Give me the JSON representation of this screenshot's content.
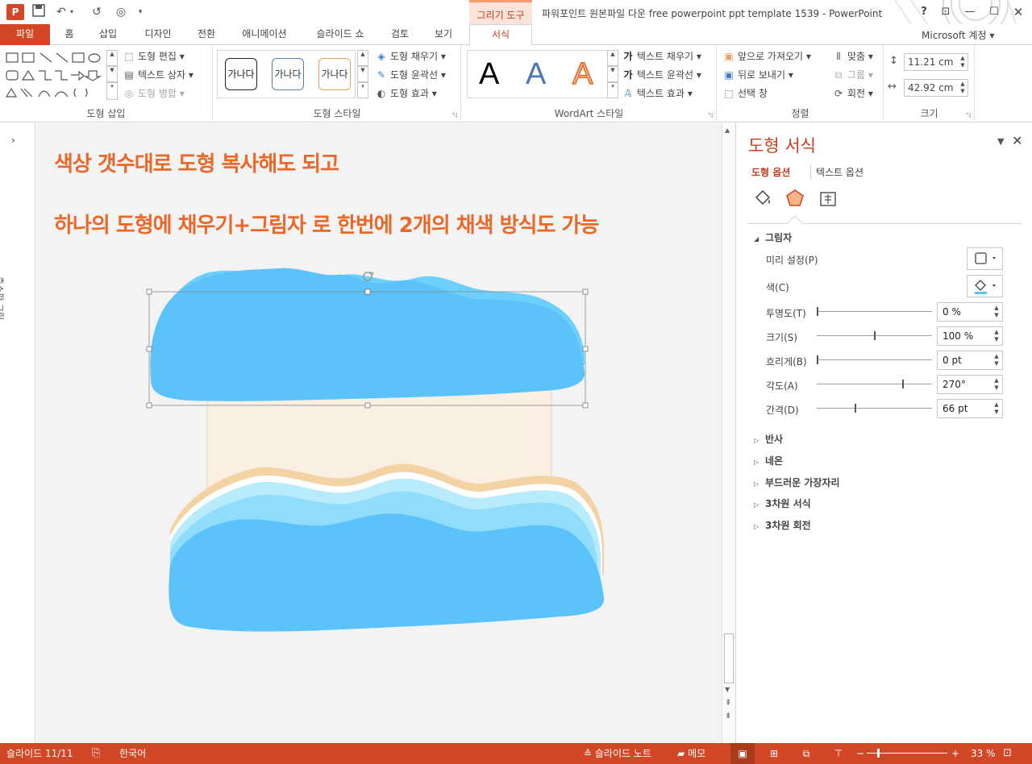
{
  "app": {
    "logo": "P",
    "window_title": "파워포인트 원본파일 다운 free powerpoint ppt template 1539 - PowerPoint",
    "context_label": "그리기 도구",
    "account": "Microsoft 계정"
  },
  "qat": {
    "save": "save-icon",
    "undo": "undo-icon",
    "redo": "redo-icon",
    "present": "present-icon",
    "customize": "customize-icon"
  },
  "window_buttons": {
    "help": "?",
    "ribbon_options": "ribbon-display-icon",
    "minimize": "minimize-icon",
    "restore": "restore-icon",
    "close": "close-icon"
  },
  "tabs": [
    {
      "id": "file",
      "label": "파일"
    },
    {
      "id": "home",
      "label": "홈"
    },
    {
      "id": "insert",
      "label": "삽입"
    },
    {
      "id": "design",
      "label": "디자인"
    },
    {
      "id": "transitions",
      "label": "전환"
    },
    {
      "id": "animations",
      "label": "애니메이션"
    },
    {
      "id": "slideshow",
      "label": "슬라이드 쇼"
    },
    {
      "id": "review",
      "label": "검토"
    },
    {
      "id": "view",
      "label": "보기"
    },
    {
      "id": "format",
      "label": "서식"
    }
  ],
  "ribbon": {
    "insert_shapes": {
      "label": "도형 삽입",
      "edit_shape": "도형 편집",
      "text_box": "텍스트 상자",
      "merge_shapes": "도형 병합"
    },
    "shape_styles": {
      "label": "도형 스타일",
      "sample_text": "가나다",
      "fill": "도형 채우기",
      "outline": "도형 윤곽선",
      "effects": "도형 효과",
      "style_colors": [
        "#222222",
        "#5b7fa6",
        "#e8a15a"
      ]
    },
    "wordart_styles": {
      "label": "WordArt 스타일",
      "sample": "A",
      "text_fill": "텍스트 채우기",
      "text_outline": "텍스트 윤곽선",
      "text_effects": "텍스트 효과"
    },
    "arrange": {
      "label": "정렬",
      "bring_forward": "앞으로 가져오기",
      "send_backward": "뒤로 보내기",
      "selection_pane": "선택 창",
      "align": "맞춤",
      "group": "그룹",
      "rotate": "회전"
    },
    "size": {
      "label": "크기",
      "height": "11.21 cm",
      "width": "42.92 cm"
    }
  },
  "thumbnails": {
    "label": "축소판 그림",
    "toggle": "chevron-right-icon"
  },
  "slide": {
    "line1": "색상 갯수대로 도형 복사해도 되고",
    "line2": "하나의 도형에 채우기+그림자 로 한번에 2개의 채색 방식도 가능",
    "colors": {
      "text": "#e8692a",
      "wave_top": "#5bc4f7",
      "wave_blue": "#5cc3fa",
      "wave_light1": "#8fdcfb",
      "wave_light2": "#b8ebfc",
      "wave_white": "#ffffff",
      "wave_sand": "#f3d3a4",
      "rect_fill": "#fbefe2"
    }
  },
  "format_pane": {
    "title": "도형 서식",
    "tab_shape": "도형 옵션",
    "tab_text": "텍스트 옵션",
    "icons": [
      "fill-line-icon",
      "effects-icon",
      "size-properties-icon"
    ],
    "shadow": {
      "heading": "그림자",
      "preset": "미리 설정(P)",
      "color": "색(C)",
      "transparency": {
        "label": "투명도(T)",
        "value": "0 %",
        "level": 0
      },
      "size": {
        "label": "크기(S)",
        "value": "100 %",
        "level": 0.5
      },
      "blur": {
        "label": "흐리게(B)",
        "value": "0 pt",
        "level": 0
      },
      "angle": {
        "label": "각도(A)",
        "value": "270°",
        "level": 0.75
      },
      "distance": {
        "label": "간격(D)",
        "value": "66 pt",
        "level": 0.33
      }
    },
    "sections": [
      "반사",
      "네온",
      "부드러운 가장자리",
      "3차원 서식",
      "3차원 회전"
    ]
  },
  "status": {
    "slide": "슬라이드 11/11",
    "language": "한국어",
    "notes": "슬라이드 노트",
    "comments": "메모",
    "zoom": "33 %"
  }
}
